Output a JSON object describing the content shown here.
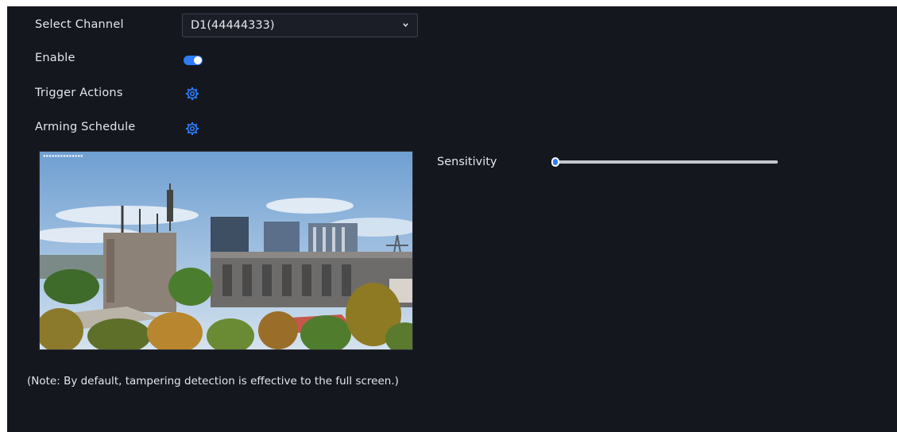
{
  "form": {
    "channel_label": "Select Channel",
    "channel_value": "D1(44444333)",
    "enable_label": "Enable",
    "enable_on": true,
    "trigger_label": "Trigger Actions",
    "schedule_label": "Arming Schedule",
    "sensitivity_label": "Sensitivity",
    "sensitivity_level": 0,
    "note": "(Note: By default, tampering detection is effective to the full screen.)"
  },
  "icons": {
    "dropdown": "chevron-down-icon",
    "trigger": "gear-icon",
    "schedule": "gear-icon"
  },
  "colors": {
    "background": "#15171f",
    "accent": "#2e7cf6"
  }
}
